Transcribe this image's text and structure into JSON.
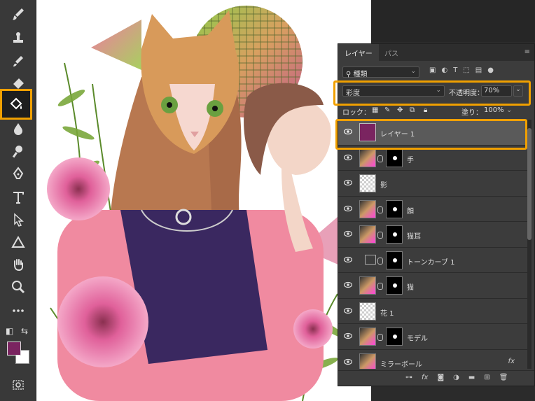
{
  "panel": {
    "tab_layers": "レイヤー",
    "tab_paths": "パス",
    "menu_icon": "≡",
    "filter": {
      "kind": "種類",
      "icons": [
        "image-filter-icon",
        "adjustment-filter-icon",
        "text-filter-icon",
        "shape-filter-icon",
        "smart-object-filter-icon"
      ]
    },
    "blend_mode": "彩度",
    "opacity_label": "不透明度：",
    "opacity_value": "70%",
    "lock_label": "ロック：",
    "fill_label": "塗り：",
    "fill_value": "100%",
    "layers": [
      {
        "name": "レイヤー 1",
        "selected": true,
        "thumb": "purple"
      },
      {
        "name": "手",
        "thumb": "img",
        "mask": true
      },
      {
        "name": "影",
        "thumb": "check"
      },
      {
        "name": "顔",
        "thumb": "img",
        "mask": true
      },
      {
        "name": "猫耳",
        "thumb": "img",
        "mask": true
      },
      {
        "name": "トーンカーブ 1",
        "thumb": "curve",
        "mask": true
      },
      {
        "name": "猫",
        "thumb": "img",
        "mask": true
      },
      {
        "name": "花 1",
        "thumb": "check"
      },
      {
        "name": "モデル",
        "thumb": "img",
        "mask": true
      },
      {
        "name": "ミラーボール",
        "thumb": "img",
        "fx": "fx"
      }
    ],
    "bottom_icons": [
      "link-icon",
      "fx-icon",
      "mask-icon",
      "adjustment-icon",
      "folder-icon",
      "new-layer-icon",
      "trash-icon"
    ],
    "bottom_fx_label": "fx"
  },
  "toolbar": {
    "foreground_color": "#7a2460",
    "background_color": "#ffffff"
  }
}
